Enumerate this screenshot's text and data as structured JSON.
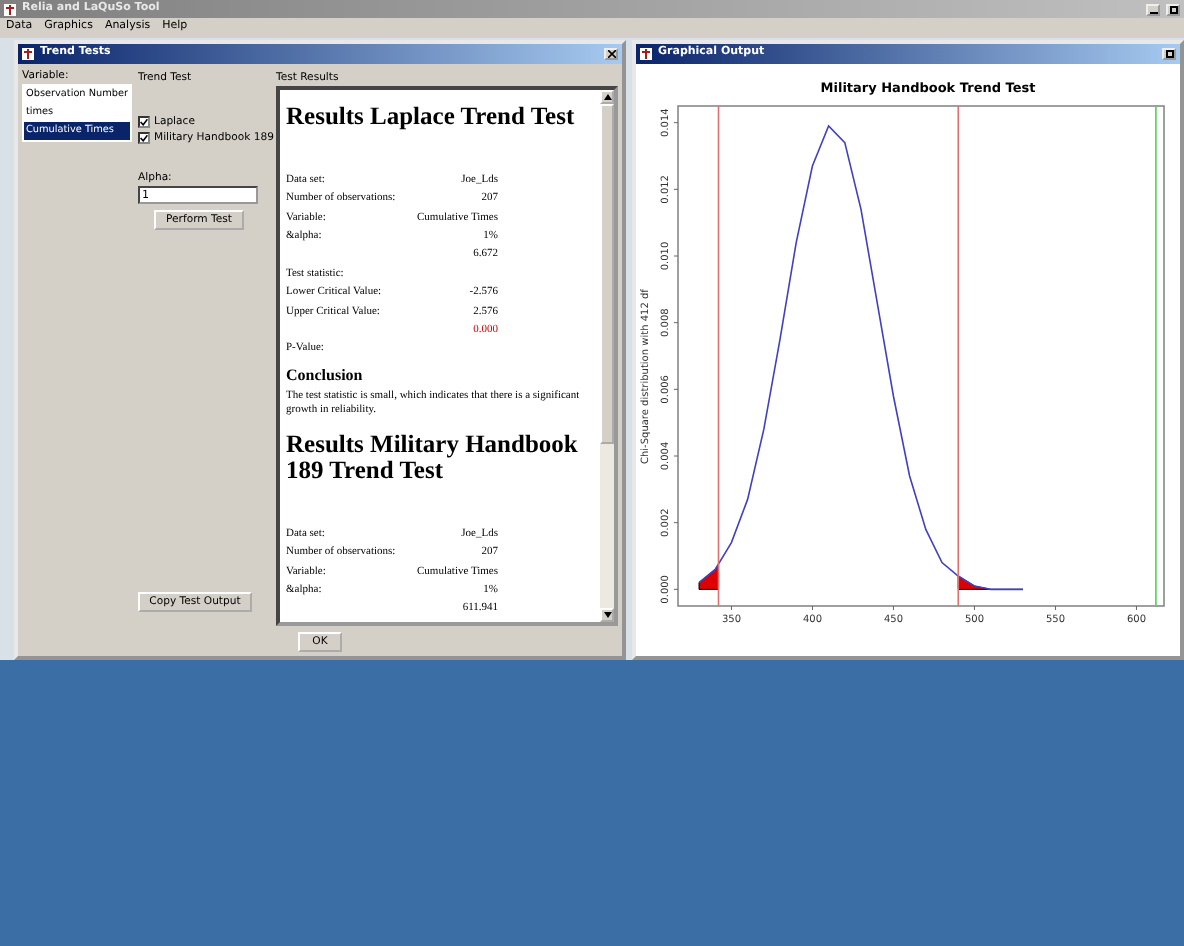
{
  "app": {
    "title": "Relia and LaQuSo Tool",
    "menu": [
      "Data",
      "Graphics",
      "Analysis",
      "Help"
    ]
  },
  "trend_window": {
    "title": "Trend Tests",
    "variable": {
      "label": "Variable:",
      "items": [
        {
          "label": "Observation Number",
          "selected": false
        },
        {
          "label": "times",
          "selected": false
        },
        {
          "label": "Cumulative Times",
          "selected": true
        }
      ]
    },
    "trend_test": {
      "label": "Trend Test",
      "options": [
        {
          "label": "Laplace",
          "checked": true
        },
        {
          "label": "Military Handbook 189",
          "checked": true
        }
      ]
    },
    "alpha": {
      "label": "Alpha:",
      "value": "1"
    },
    "perform_button": "Perform Test",
    "copy_button": "Copy Test Output",
    "results": {
      "label": "Test Results",
      "blocks": [
        {
          "kind": "heading",
          "text": "Results Laplace Trend Test"
        },
        {
          "kind": "row",
          "label": "Data set:",
          "value": "Joe_Lds",
          "alert": false
        },
        {
          "kind": "row",
          "label": "Number of observations:",
          "value": "207",
          "alert": false
        },
        {
          "kind": "row",
          "label": "Variable:",
          "value": "Cumulative Times",
          "alert": false
        },
        {
          "kind": "row",
          "label": "&alpha:",
          "value": "1%",
          "alert": false
        },
        {
          "kind": "row",
          "value": "6.672",
          "alert": false
        },
        {
          "kind": "row",
          "label": "Test statistic:"
        },
        {
          "kind": "row",
          "label": "Lower Critical Value:",
          "value": "-2.576",
          "alert": false
        },
        {
          "kind": "row",
          "label": "Upper Critical Value:",
          "value": "2.576",
          "alert": false
        },
        {
          "kind": "row",
          "value": "0.000",
          "alert": true
        },
        {
          "kind": "row",
          "label": "P-Value:"
        },
        {
          "kind": "subheading",
          "text": "Conclusion"
        },
        {
          "kind": "paragraph",
          "text": "The test statistic is small, which indicates that there is a significant growth in reliability."
        },
        {
          "kind": "heading",
          "text": "Results Military Handbook 189 Trend Test"
        },
        {
          "kind": "row",
          "label": "Data set:",
          "value": "Joe_Lds",
          "alert": false
        },
        {
          "kind": "row",
          "label": "Number of observations:",
          "value": "207",
          "alert": false
        },
        {
          "kind": "row",
          "label": "Variable:",
          "value": "Cumulative Times",
          "alert": false
        },
        {
          "kind": "row",
          "label": "&alpha:",
          "value": "1%",
          "alert": false
        },
        {
          "kind": "row",
          "value": "611.941",
          "alert": false
        }
      ]
    },
    "ok_button": "OK"
  },
  "graph_window": {
    "title": "Graphical Output",
    "chart_data": {
      "type": "line",
      "title": "Military Handbook Trend Test",
      "ylabel": "Chi-Square distribution with 412 df",
      "x": [
        330,
        340,
        350,
        360,
        370,
        380,
        390,
        400,
        410,
        420,
        430,
        440,
        450,
        460,
        470,
        480,
        490,
        500,
        510,
        520,
        530
      ],
      "series": [
        {
          "color": "#4040c0",
          "values": [
            0.0002,
            0.0006,
            0.0014,
            0.0027,
            0.0048,
            0.0075,
            0.0104,
            0.0127,
            0.0139,
            0.0134,
            0.0114,
            0.0086,
            0.0058,
            0.0034,
            0.0018,
            0.0008,
            0.0004,
            0.0001,
            0,
            0,
            0
          ]
        }
      ],
      "xlim": [
        317,
        617
      ],
      "ylim": [
        -0.0005,
        0.0145
      ],
      "xticks": [
        350,
        400,
        450,
        500,
        550,
        600
      ],
      "yticks": [
        {
          "value": 0,
          "label": "0.000"
        },
        {
          "value": 0.002,
          "label": "0.002"
        },
        {
          "value": 0.004,
          "label": "0.004"
        },
        {
          "value": 0.006,
          "label": "0.006"
        },
        {
          "value": 0.008,
          "label": "0.008"
        },
        {
          "value": 0.01,
          "label": "0.010"
        },
        {
          "value": 0.012,
          "label": "0.012"
        },
        {
          "value": 0.014,
          "label": "0.014"
        }
      ],
      "ref_lines": [
        {
          "axis": "x",
          "value": 342,
          "color": "#e07070"
        },
        {
          "axis": "x",
          "value": 490,
          "color": "#e07070"
        },
        {
          "axis": "x",
          "value": 612,
          "color": "#50d050"
        }
      ]
    }
  }
}
